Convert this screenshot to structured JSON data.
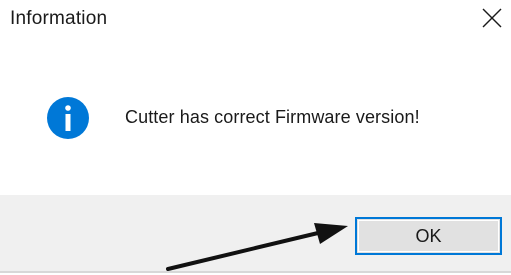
{
  "dialog": {
    "title": "Information",
    "message": "Cutter has correct Firmware version!",
    "icon": "info-icon",
    "close_icon": "close-icon",
    "ok_label": "OK"
  },
  "colors": {
    "icon_blue": "#0078d7",
    "footer_bg": "#f0f0f0",
    "button_bg": "#e1e1e1",
    "button_border": "#0078d7",
    "annotation_arrow": "#111111"
  }
}
